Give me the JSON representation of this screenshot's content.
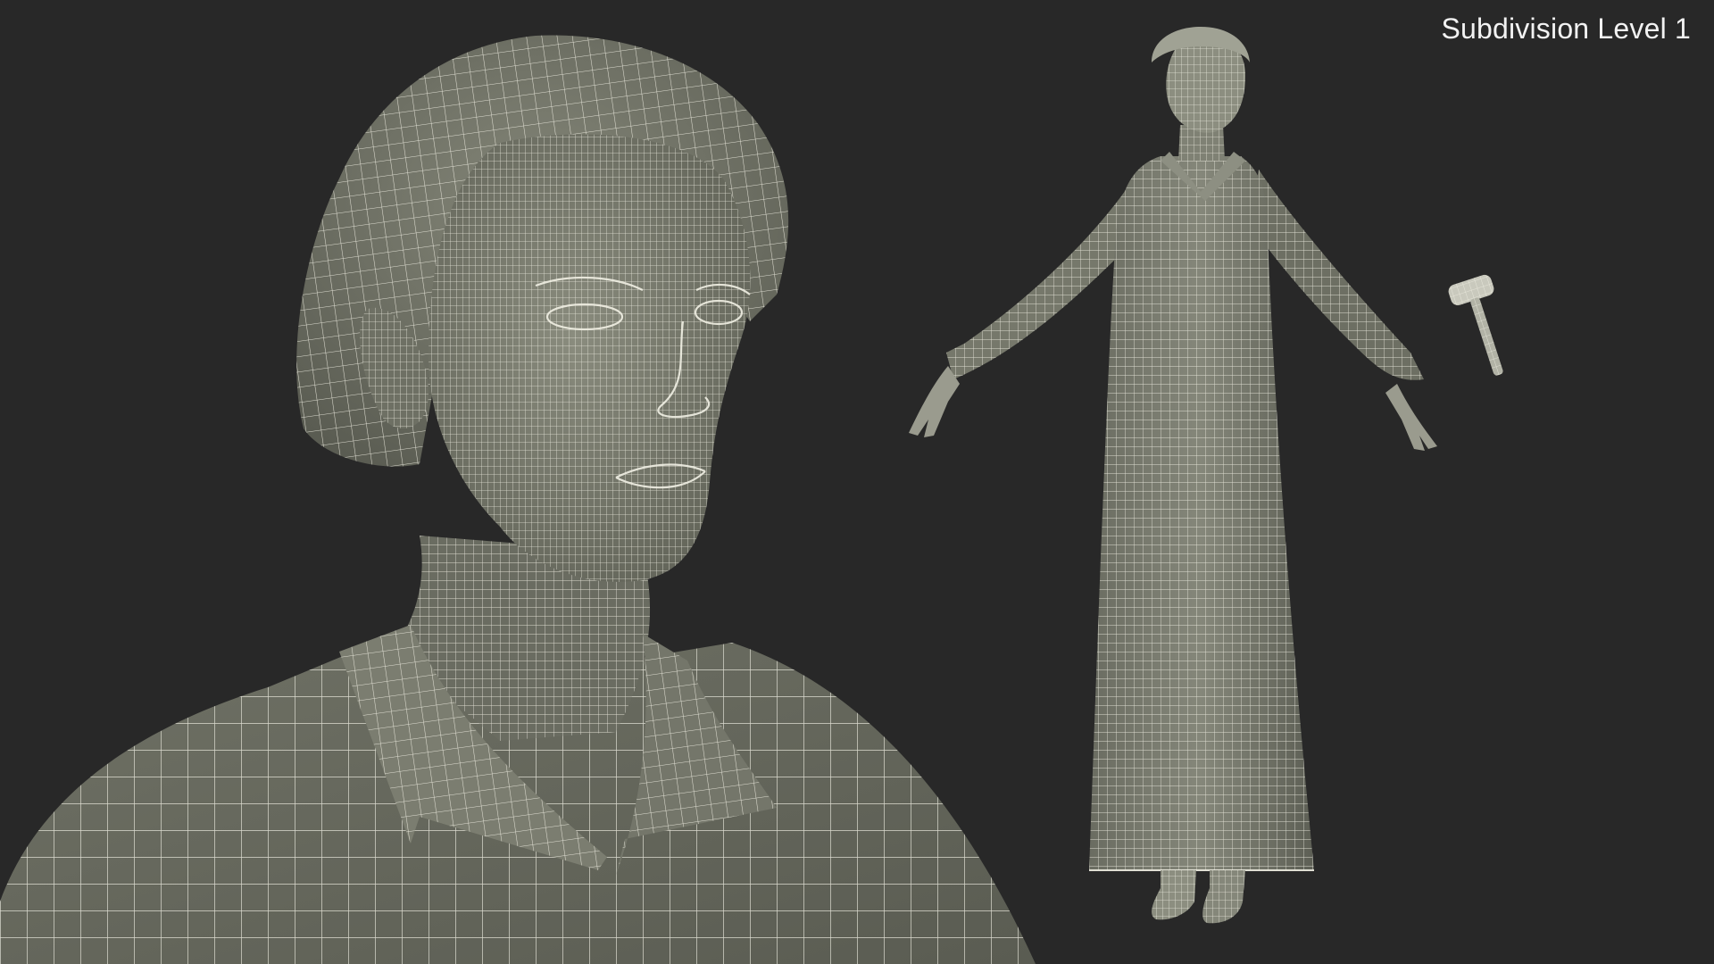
{
  "overlay": {
    "subdivision_label": "Subdivision Level 1"
  },
  "colors": {
    "background": "#282828",
    "mesh_fill": "#787a6c",
    "mesh_shadow": "#4f5148",
    "wire": "#f1f0e4",
    "label_text": "#f2f2f2"
  },
  "icons": {
    "closeup": "wireframe-bust-icon",
    "full_body": "wireframe-figure-icon",
    "prop": "wireframe-gavel-icon"
  }
}
